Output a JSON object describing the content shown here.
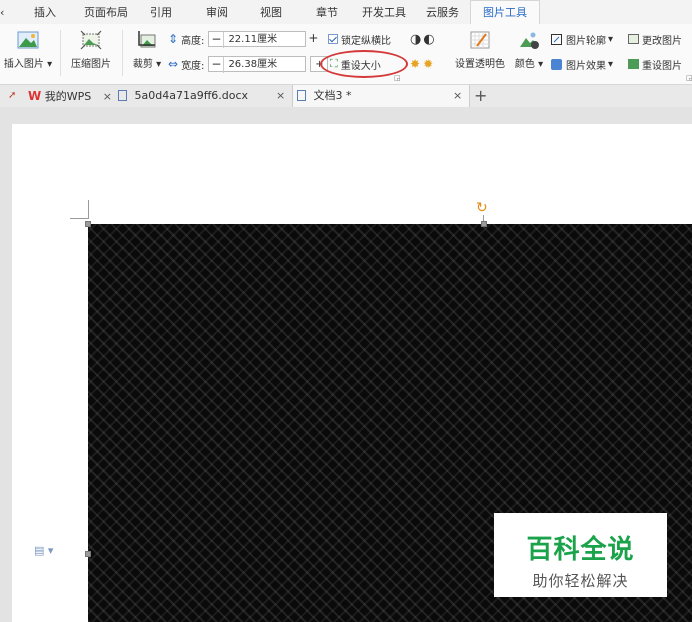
{
  "menu": {
    "tabs": [
      "插入",
      "页面布局",
      "引用",
      "审阅",
      "视图",
      "章节",
      "开发工具",
      "云服务",
      "图片工具"
    ],
    "active_tab": "图片工具"
  },
  "ribbon": {
    "insert_picture": "插入图片",
    "compress_picture": "压缩图片",
    "crop": "裁剪",
    "height_label": "高度:",
    "height_value": "22.11厘米",
    "width_label": "宽度:",
    "width_value": "26.38厘米",
    "lock_aspect": "锁定纵横比",
    "reset_size": "重设大小",
    "set_transparent": "设置透明色",
    "color": "颜色",
    "picture_outline": "图片轮廓",
    "picture_effect": "图片效果",
    "change_picture": "更改图片",
    "reset_picture": "重设图片",
    "minus": "−",
    "plus": "+"
  },
  "doc_tabs": {
    "home": "我的WPS",
    "tab1": "5a0d4a71a9ff6.docx",
    "tab2": "文档3 *",
    "close": "×",
    "add": "+"
  },
  "watermark": {
    "title": "百科全说",
    "subtitle": "助你轻松解决"
  },
  "colors": {
    "accent": "#2a6cc8",
    "highlight": "#d43a3a",
    "watermark_green": "#1aa34a"
  }
}
